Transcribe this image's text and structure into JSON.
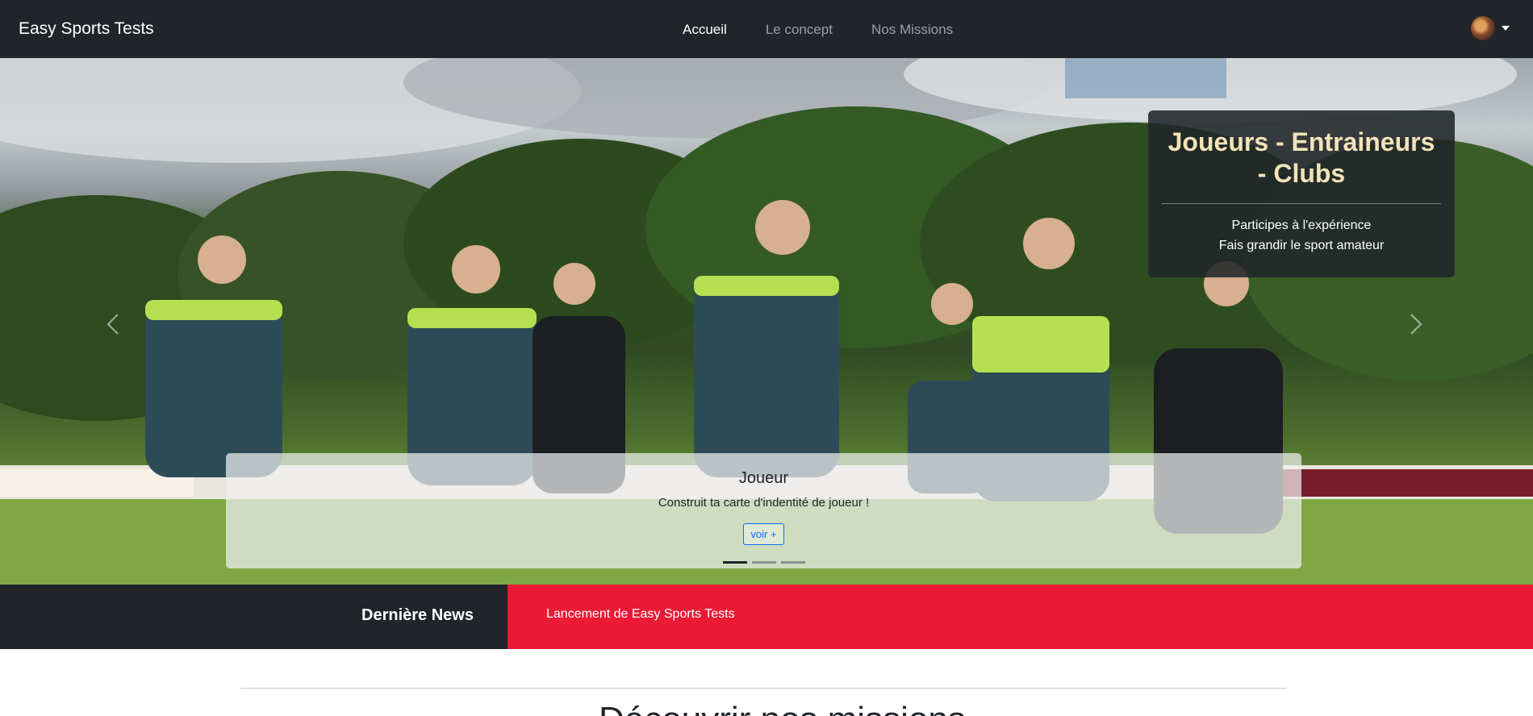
{
  "navbar": {
    "brand": "Easy Sports Tests",
    "links": [
      {
        "label": "Accueil",
        "active": true
      },
      {
        "label": "Le concept",
        "active": false
      },
      {
        "label": "Nos Missions",
        "active": false
      }
    ]
  },
  "hero": {
    "side_caption": {
      "title": "Joueurs - Entraineurs - Clubs",
      "line1": "Participes à l'expérience",
      "line2": "Fais grandir le sport amateur"
    },
    "slide": {
      "title": "Joueur",
      "text": "Construit ta carte d'indentité de joueur !",
      "button": "voir +"
    },
    "indicators_count": 3,
    "active_indicator": 1
  },
  "news": {
    "label": "Dernière News",
    "item": "Lancement de Easy Sports Tests"
  },
  "section": {
    "title": "Découvrir nos missions"
  },
  "colors": {
    "navbar": "#212529",
    "news_accent": "#ec1a35",
    "side_caption_title": "#f3e3b8",
    "button": "#0d6efd"
  }
}
